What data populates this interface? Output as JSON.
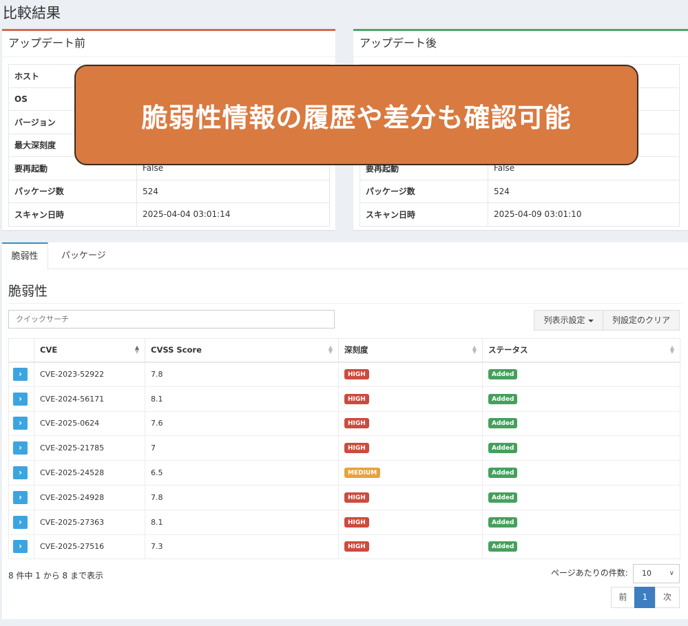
{
  "page": {
    "title": "比較結果"
  },
  "before": {
    "title": "アップデート前",
    "rows": [
      {
        "key": "ホスト",
        "value": ""
      },
      {
        "key": "OS",
        "value": ""
      },
      {
        "key": "バージョン",
        "value": ""
      },
      {
        "key": "最大深刻度",
        "value": ""
      },
      {
        "key": "要再起動",
        "value": "False"
      },
      {
        "key": "パッケージ数",
        "value": "524"
      },
      {
        "key": "スキャン日時",
        "value": "2025-04-04 03:01:14"
      }
    ]
  },
  "after": {
    "title": "アップデート後",
    "rows": [
      {
        "key": "",
        "value": ""
      },
      {
        "key": "",
        "value": ""
      },
      {
        "key": "",
        "value": ""
      },
      {
        "key": "",
        "value": ""
      },
      {
        "key": "要再起動",
        "value": "False"
      },
      {
        "key": "パッケージ数",
        "value": "524"
      },
      {
        "key": "スキャン日時",
        "value": "2025-04-09 03:01:10"
      }
    ]
  },
  "banner": {
    "text": "脆弱性情報の履歴や差分も確認可能"
  },
  "tabs": {
    "vuln": "脆弱性",
    "packages": "パッケージ"
  },
  "section": {
    "title": "脆弱性"
  },
  "search": {
    "placeholder": "クイックサーチ"
  },
  "buttons": {
    "columns": "列表示設定",
    "clear": "列設定のクリア"
  },
  "table": {
    "headers": {
      "cve": "CVE",
      "score": "CVSS Score",
      "severity": "深刻度",
      "status": "ステータス"
    },
    "rows": [
      {
        "expand": "›",
        "cve": "CVE-2023-52922",
        "score": "7.8",
        "severity": "HIGH",
        "status": "Added"
      },
      {
        "expand": "›",
        "cve": "CVE-2024-56171",
        "score": "8.1",
        "severity": "HIGH",
        "status": "Added"
      },
      {
        "expand": "›",
        "cve": "CVE-2025-0624",
        "score": "7.6",
        "severity": "HIGH",
        "status": "Added"
      },
      {
        "expand": "›",
        "cve": "CVE-2025-21785",
        "score": "7",
        "severity": "HIGH",
        "status": "Added"
      },
      {
        "expand": "›",
        "cve": "CVE-2025-24528",
        "score": "6.5",
        "severity": "MEDIUM",
        "status": "Added"
      },
      {
        "expand": "›",
        "cve": "CVE-2025-24928",
        "score": "7.8",
        "severity": "HIGH",
        "status": "Added"
      },
      {
        "expand": "›",
        "cve": "CVE-2025-27363",
        "score": "8.1",
        "severity": "HIGH",
        "status": "Added"
      },
      {
        "expand": "›",
        "cve": "CVE-2025-27516",
        "score": "7.3",
        "severity": "HIGH",
        "status": "Added"
      }
    ]
  },
  "footer": {
    "info": "8 件中 1 から 8 まで表示",
    "per_page_label": "ページあたりの件数:",
    "per_page_value": "10",
    "prev": "前",
    "current": "1",
    "next": "次"
  },
  "colors": {
    "high": "#cd4b3d",
    "medium": "#e8a23b",
    "added": "#45a05d",
    "banner": "#d97a41"
  }
}
